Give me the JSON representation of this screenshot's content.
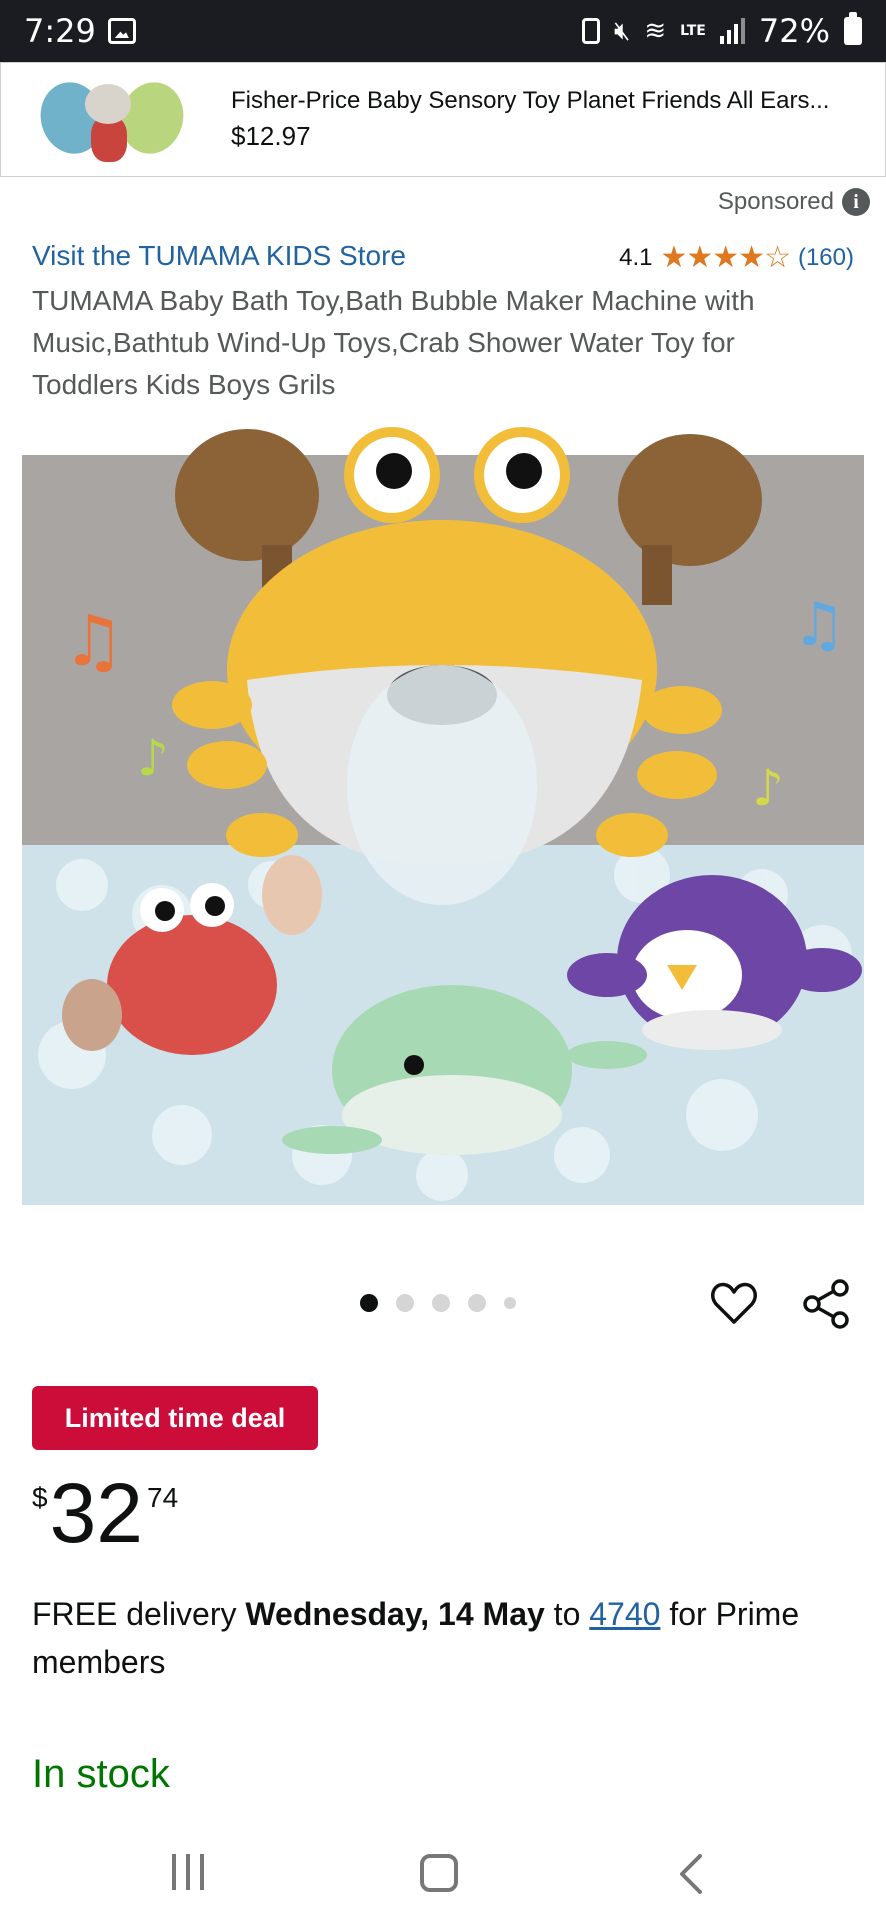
{
  "status_bar": {
    "time": "7:29",
    "battery": "72%",
    "network": "LTE"
  },
  "sponsored_card": {
    "title": "Fisher-Price Baby Sensory Toy Planet Friends All Ears...",
    "price": "$12.97"
  },
  "sponsored_label": "Sponsored",
  "store_link": "Visit the TUMAMA KIDS Store",
  "rating": {
    "value": "4.1",
    "stars_glyphs": "★★★★☆",
    "count": "(160)"
  },
  "product_title": "TUMAMA Baby Bath Toy,Bath Bubble Maker Machine with Music,Bathtub Wind-Up Toys,Crab Shower Water Toy for Toddlers Kids Boys Grils",
  "image_carousel": {
    "total": 5,
    "active_index": 0
  },
  "deal_badge": "Limited time deal",
  "price": {
    "symbol": "$",
    "whole": "32",
    "fraction": "74"
  },
  "delivery": {
    "prefix": "FREE delivery ",
    "date": "Wednesday, 14 May",
    "middle": " to ",
    "postcode": "4740",
    "suffix": " for Prime members"
  },
  "stock_status": "In stock",
  "colors": {
    "link": "#2162a1",
    "deal": "#cc0c39",
    "stars": "#de7921",
    "in_stock": "#007600"
  }
}
